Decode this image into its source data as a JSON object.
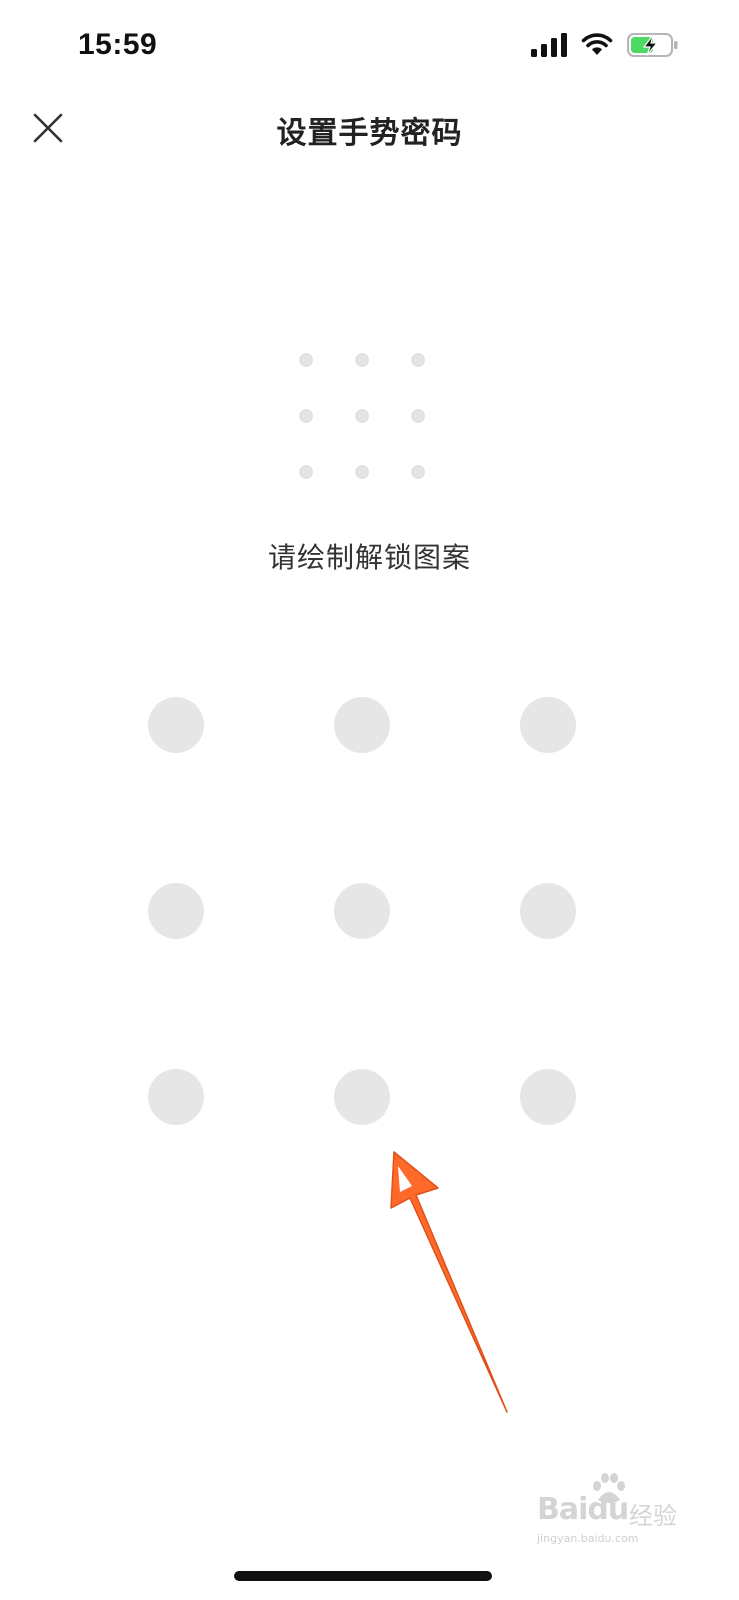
{
  "status_bar": {
    "time": "15:59",
    "icons": [
      "cellular-signal-icon",
      "wifi-icon",
      "battery-charging-icon"
    ],
    "battery_color": "#4cd964"
  },
  "header": {
    "title": "设置手势密码",
    "close_icon": "close-icon"
  },
  "preview_grid": {
    "rows": 3,
    "cols": 3,
    "dot_color": "#e3e3e3"
  },
  "hint": {
    "text": "请绘制解锁图案"
  },
  "pattern_grid": {
    "rows": 3,
    "cols": 3,
    "dot_color": "#e6e6e6"
  },
  "annotation": {
    "icon": "arrow-annotation-icon",
    "color": "#ff6a2b"
  },
  "watermark": {
    "main": "Baidu",
    "cn": "经验",
    "url": "jingyan.baidu.com"
  }
}
